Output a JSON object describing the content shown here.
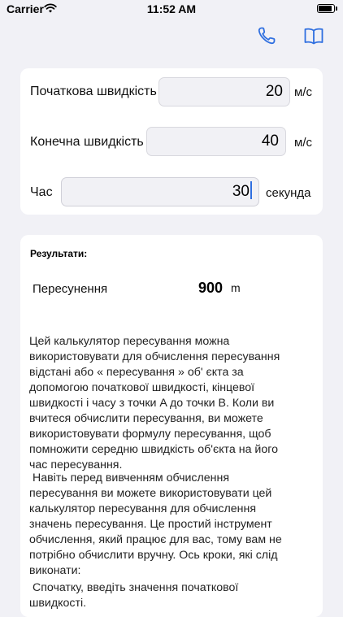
{
  "status_bar": {
    "carrier": "Carrier",
    "time": "11:52 AM"
  },
  "nav": {
    "icons": [
      "phone-icon",
      "book-icon"
    ],
    "accent_color": "#2f6fe0"
  },
  "inputs": {
    "initial_velocity": {
      "label": "Початкова швидкість",
      "value": "20",
      "unit": "м/с"
    },
    "final_velocity": {
      "label": "Конечна швидкість",
      "value": "40",
      "unit": "м/с"
    },
    "time": {
      "label": "Час",
      "value": "30",
      "unit": "секунда"
    }
  },
  "results": {
    "title": "Результати:",
    "displacement_label": "Пересунення",
    "displacement_value": "900",
    "displacement_unit": "m"
  },
  "description": {
    "p1": "Цей калькулятор пересування можна використовувати для обчислення пересування відстані або « пересування » об' єкта за допомогою початкової швидкості, кінцевої швидкості і часу з точки A до точки B. Коли ви вчитеся обчислити пересування, ви можете використовувати формулу пересування, щоб помножити середню швидкість об'єкта на його час пересування.",
    "p2": " Навіть перед вивченням обчислення пересування ви можете використовувати цей калькулятор пересування для обчислення значень пересування. Це простий інструмент обчислення, який працює для вас, тому вам не потрібно обчислити вручну. Ось кроки, які слід виконати:",
    "p3": " Спочатку, введіть значення початкової швидкості."
  }
}
